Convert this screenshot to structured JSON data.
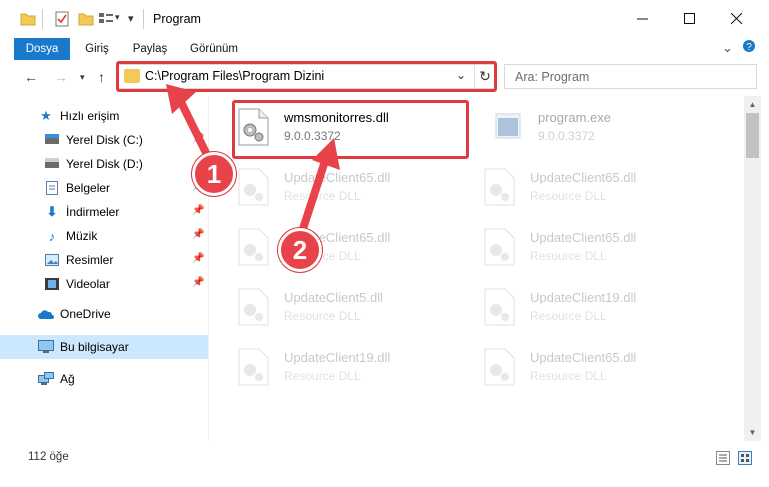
{
  "window": {
    "title": "Program"
  },
  "ribbon": {
    "tabs": [
      "Dosya",
      "Giriş",
      "Paylaş",
      "Görünüm"
    ]
  },
  "navigation": {
    "address": "C:\\Program Files\\Program Dizini",
    "search_placeholder": "Ara: Program"
  },
  "sidebar": {
    "items": [
      {
        "label": "Hızlı erişim",
        "icon": "star-icon"
      },
      {
        "label": "Yerel Disk (C:)",
        "icon": "drive-icon"
      },
      {
        "label": "Yerel Disk (D:)",
        "icon": "drive-icon"
      },
      {
        "label": "Belgeler",
        "icon": "documents-icon"
      },
      {
        "label": "İndirmeler",
        "icon": "download-icon"
      },
      {
        "label": "Müzik",
        "icon": "music-icon"
      },
      {
        "label": "Resimler",
        "icon": "pictures-icon"
      },
      {
        "label": "Videolar",
        "icon": "videos-icon"
      },
      {
        "label": "OneDrive",
        "icon": "cloud-icon"
      },
      {
        "label": "Bu bilgisayar",
        "icon": "computer-icon"
      },
      {
        "label": "Ağ",
        "icon": "network-icon"
      }
    ]
  },
  "files": [
    {
      "name": "wmsmonitorres.dll",
      "sub": "9.0.0.3372",
      "highlighted": true
    },
    {
      "name": "program.exe",
      "sub": "9.0.0.3372"
    },
    {
      "name": "UpdateClient65.dll",
      "sub": "Resource DLL"
    },
    {
      "name": "UpdateClient65.dll",
      "sub": "Resource DLL"
    },
    {
      "name": "UpdateClient65.dll",
      "sub": "Resource DLL"
    },
    {
      "name": "UpdateClient65.dll",
      "sub": "Resource DLL"
    },
    {
      "name": "UpdateClient5.dll",
      "sub": "Resource DLL"
    },
    {
      "name": "UpdateClient19.dll",
      "sub": "Resource DLL"
    },
    {
      "name": "UpdateClient19.dll",
      "sub": "Resource DLL"
    },
    {
      "name": "UpdateClient65.dll",
      "sub": "Resource DLL"
    }
  ],
  "status": {
    "item_count": "112 öğe"
  },
  "annotations": {
    "step1": "1",
    "step2": "2",
    "color": "#e8434a"
  }
}
